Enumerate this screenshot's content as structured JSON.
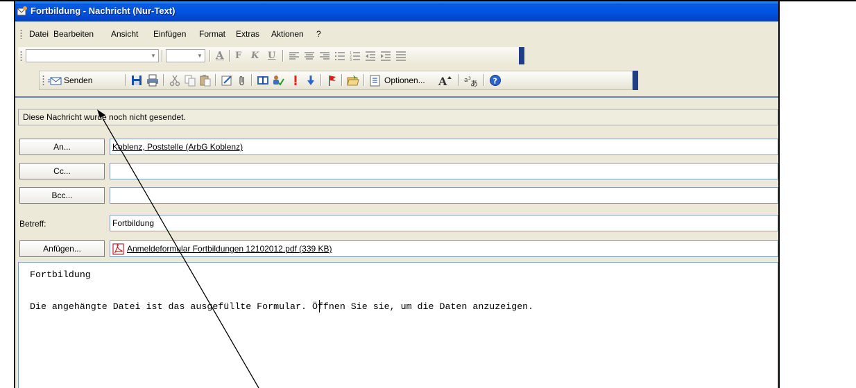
{
  "window": {
    "title": "Fortbildung - Nachricht (Nur-Text)"
  },
  "menu": {
    "items": [
      "Datei",
      "Bearbeiten",
      "Ansicht",
      "Einfügen",
      "Format",
      "Extras",
      "Aktionen",
      "?"
    ]
  },
  "toolbar": {
    "send_label": "Senden",
    "options_label": "Optionen...",
    "format_letters": [
      "A",
      "F",
      "K",
      "U"
    ]
  },
  "info_bar": {
    "text": "Diese Nachricht wurde noch nicht gesendet."
  },
  "header": {
    "to_button": "An...",
    "to_value": "Koblenz, Poststelle (ArbG Koblenz)",
    "cc_button": "Cc...",
    "cc_value": "",
    "bcc_button": "Bcc...",
    "bcc_value": "",
    "subject_label": "Betreff:",
    "subject_value": "Fortbildung",
    "attach_button": "Anfügen...",
    "attachment_name": "Anmeldeformular Fortbildungen 12102012.pdf (339 KB)"
  },
  "message": {
    "line1": "Fortbildung",
    "line2": "Die angehängte Datei ist das ausgefüllte Formular. Öffnen Sie sie, um die Daten anzuzeigen."
  },
  "colors": {
    "titlebar": "#0054e3",
    "toolbar_end": "#1f3e86",
    "annotation_arrow": "#000000"
  }
}
